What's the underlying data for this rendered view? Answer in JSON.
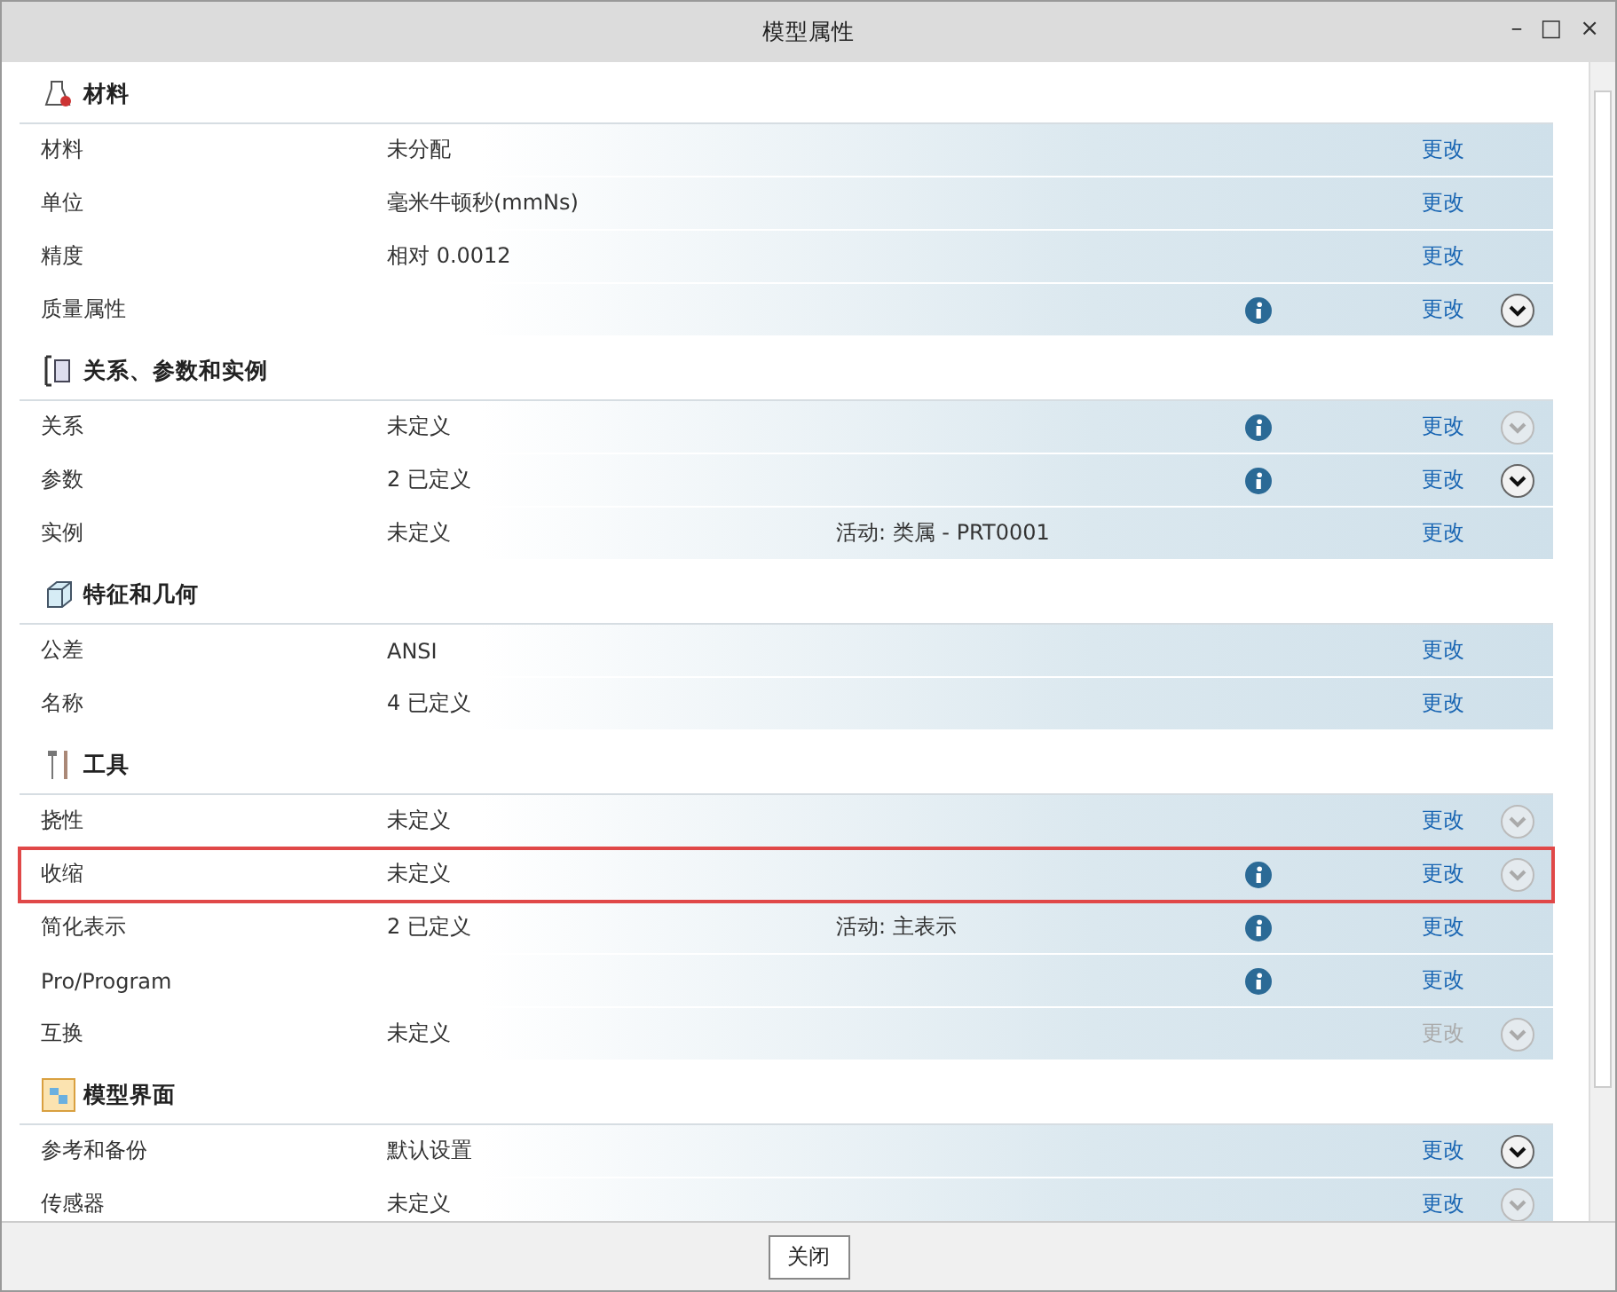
{
  "window": {
    "title": "模型属性",
    "controls": [
      "–",
      "□",
      "×"
    ]
  },
  "sections": [
    {
      "title": "材料",
      "rows": [
        {
          "name": "材料",
          "value": "未分配",
          "change": "更改",
          "change_enabled": true
        },
        {
          "name": "单位",
          "value": "毫米牛顿秒(mmNs)",
          "change": "更改",
          "change_enabled": true
        },
        {
          "name": "精度",
          "value": "相对 0.0012",
          "change": "更改",
          "change_enabled": true
        },
        {
          "name": "质量属性",
          "info": true,
          "change": "更改",
          "change_enabled": true,
          "expander": {
            "enabled": true
          }
        }
      ]
    },
    {
      "title": "关系、参数和实例",
      "rows": [
        {
          "name": "关系",
          "value": "未定义",
          "info": true,
          "change": "更改",
          "change_enabled": true,
          "expander": {
            "enabled": false
          }
        },
        {
          "name": "参数",
          "value": "2 已定义",
          "info": true,
          "change": "更改",
          "change_enabled": true,
          "expander": {
            "enabled": true
          }
        },
        {
          "name": "实例",
          "value": "未定义",
          "extra": "活动: 类属 - PRT0001",
          "change": "更改",
          "change_enabled": true
        }
      ]
    },
    {
      "title": "特征和几何",
      "rows": [
        {
          "name": "公差",
          "value": "ANSI",
          "change": "更改",
          "change_enabled": true
        },
        {
          "name": "名称",
          "value": "4 已定义",
          "change": "更改",
          "change_enabled": true
        }
      ]
    },
    {
      "title": "工具",
      "rows": [
        {
          "name": "挠性",
          "value": "未定义",
          "change": "更改",
          "change_enabled": true,
          "expander": {
            "enabled": false
          }
        },
        {
          "name": "收缩",
          "value": "未定义",
          "info": true,
          "change": "更改",
          "change_enabled": true,
          "expander": {
            "enabled": false
          },
          "highlighted": true
        },
        {
          "name": "简化表示",
          "value": "2 已定义",
          "extra": "活动: 主表示",
          "info": true,
          "change": "更改",
          "change_enabled": true
        },
        {
          "name": "Pro/Program",
          "info": true,
          "change": "更改",
          "change_enabled": true
        },
        {
          "name": "互换",
          "value": "未定义",
          "change": "更改",
          "change_enabled": false,
          "expander": {
            "enabled": false
          }
        }
      ]
    },
    {
      "title": "模型界面",
      "rows": [
        {
          "name": "参考和备份",
          "value": "默认设置",
          "change": "更改",
          "change_enabled": true,
          "expander": {
            "enabled": true
          }
        },
        {
          "name": "传感器",
          "value": "未定义",
          "change": "更改",
          "change_enabled": true,
          "expander": {
            "enabled": false
          }
        }
      ]
    }
  ],
  "footer": {
    "close_button": "关闭"
  }
}
